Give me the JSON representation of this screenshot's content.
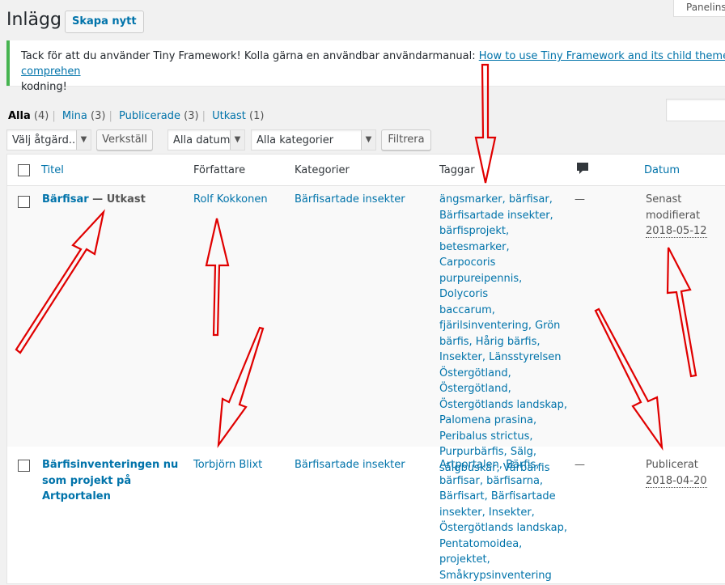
{
  "header": {
    "title": "Inlägg",
    "add_new": "Skapa nytt",
    "screen_options": "Panelinst"
  },
  "notice": {
    "text": "Tack för att du använder Tiny Framework! Kolla gärna en användbar användarmanual: ",
    "link": "How to use Tiny Framework and its child themes: a comprehen",
    "text_end": "kodning!"
  },
  "views": [
    {
      "label": "Alla",
      "count": "(4)"
    },
    {
      "label": "Mina",
      "count": "(3)"
    },
    {
      "label": "Publicerade",
      "count": "(3)"
    },
    {
      "label": "Utkast",
      "count": "(1)"
    }
  ],
  "filters": {
    "bulk_action": "Välj åtgärd...",
    "apply": "Verkställ",
    "dates": "Alla datum",
    "categories": "Alla kategorier",
    "filter": "Filtrera"
  },
  "columns": {
    "title": "Titel",
    "author": "Författare",
    "categories": "Kategorier",
    "tags": "Taggar",
    "comments_icon": "comment-icon",
    "date": "Datum"
  },
  "posts": [
    {
      "title": "Bärfisar",
      "state": " — Utkast",
      "author": "Rolf Kokkonen",
      "category": "Bärfisartade insekter",
      "tags": [
        "ängsmarker, bärfisar,",
        "Bärfisartade insekter,",
        "bärfisprojekt, betesmarker,",
        "Carpocoris",
        "purpureipennis, Dolycoris",
        "baccarum,",
        "fjärilsinventering, Grön",
        "bärfis, Hårig bärfis,",
        "Insekter, Länsstyrelsen",
        "Östergötland,",
        "Östergötland,",
        "Östergötlands landskap,",
        "Palomena prasina,",
        "Peribalus strictus,",
        "Purpurbärfis, Sälg,",
        "sälgbuskar, Vårbärfis"
      ],
      "comments": "—",
      "date_status": [
        "Senast",
        "modifierat"
      ],
      "date": "2018-05-12"
    },
    {
      "title_lines": [
        "Bärfisinventeringen nu",
        "som projekt på",
        "Artportalen"
      ],
      "author": "Torbjörn Blixt",
      "category": "Bärfisartade insekter",
      "tags": [
        "Artportalen, Bärfis,",
        "bärfisar, bärfisarna,",
        "Bärfisart, Bärfisartade",
        "insekter, Insekter,",
        "Östergötlands landskap,",
        "Pentatomoidea, projektet,",
        "Småkrypsinventering"
      ],
      "comments": "—",
      "date_status": [
        "Publicerat"
      ],
      "date": "2018-04-20"
    }
  ],
  "annotation_color": "#e00000"
}
